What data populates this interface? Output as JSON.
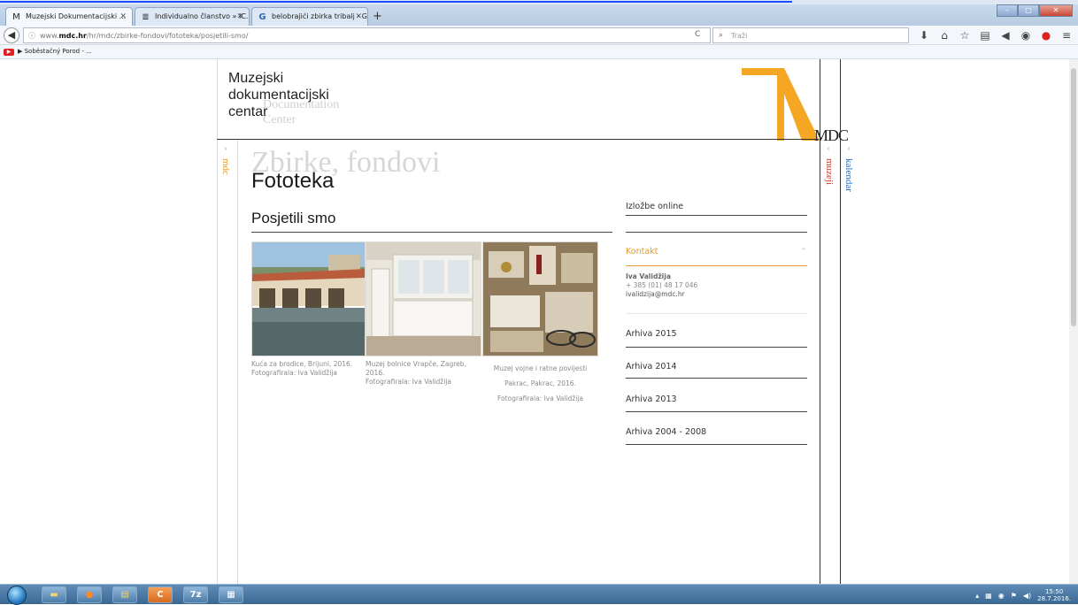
{
  "browser": {
    "tabs": [
      {
        "icon": "M",
        "label": "Muzejski Dokumentacijski ...",
        "active": true
      },
      {
        "icon": "≣",
        "label": "Individualno članstvo » IC...",
        "active": false
      },
      {
        "icon": "G",
        "label": "belobrajići zbirka tribalj - G...",
        "active": false
      }
    ],
    "url_prefix": "www.",
    "url_domain": "mdc.hr",
    "url_path": "/hr/mdc/zbirke-fondovi/fototeka/posjetili-smo/",
    "search_placeholder": "Traži",
    "bookmark": "▶ Soběstačný Porod - ..."
  },
  "site": {
    "title_line1": "Muzejski",
    "title_line2": "dokumentacijski",
    "title_line3": "centar",
    "title_ghost1": "Documentation",
    "title_ghost2": "Center",
    "logo_text": "MDC",
    "side_left": "mdc",
    "side_right1": "muzeji",
    "side_right2": "kalendar",
    "ghost_heading": "Zbirke, fondovi",
    "page_title": "Fototeka",
    "section_title": "Posjetili smo"
  },
  "photos": [
    {
      "caption_line1": "Kuća za brodice, Brijuni, 2016.",
      "caption_line2": "Fotografirala: Iva Validžija"
    },
    {
      "caption_line1": "Muzej bolnice Vrapče, Zagreb,",
      "caption_line2": "2016.",
      "caption_line3": "Fotografirala: Iva Validžija"
    },
    {
      "caption_line1": "Muzej vojne i ratne povijesti",
      "caption_line2": "Pakrac, Pakrac, 2016.",
      "caption_line3": "Fotografirala: Iva Validžija"
    }
  ],
  "sidebar": {
    "izlozbe": "Izložbe online",
    "kontakt": "Kontakt",
    "contact_name": "Iva Validžija",
    "contact_phone": "+ 385 (01) 48 17 046",
    "contact_email": "ivalidzija@mdc.hr",
    "arhiva_2015": "Arhiva 2015",
    "arhiva_2014": "Arhiva 2014",
    "arhiva_2013": "Arhiva 2013",
    "arhiva_2004": "Arhiva 2004 - 2008"
  },
  "taskbar": {
    "time": "15:50",
    "date": "28.7.2016."
  },
  "colors": {
    "accent": "#e39a2b",
    "muzeji": "#c0392b",
    "kalendar": "#2a6db5"
  }
}
